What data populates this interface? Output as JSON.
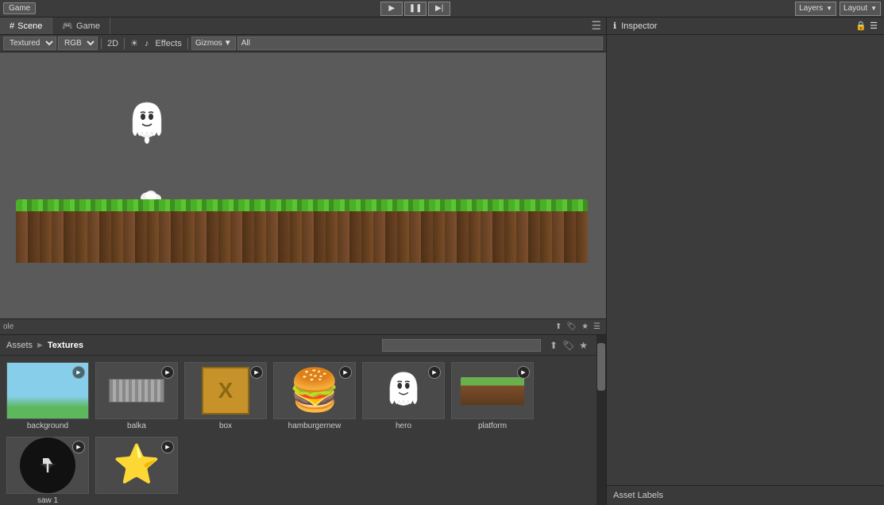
{
  "topbar": {
    "game_label": "Game",
    "layers_label": "Layers",
    "layout_label": "Layout",
    "play_icon": "▶",
    "pause_icon": "❚❚",
    "step_icon": "▶|"
  },
  "tabs": {
    "scene_label": "Scene",
    "game_label": "Game",
    "scene_hash": "#",
    "game_hash": "🎮"
  },
  "scene_toolbar": {
    "mode": "Textured",
    "color": "RGB",
    "view": "2D",
    "effects_label": "Effects",
    "gizmos_label": "Gizmos",
    "all_value": "All"
  },
  "inspector": {
    "title": "Inspector",
    "asset_labels_title": "Asset Labels"
  },
  "bottom_panel": {
    "console_label": "ole",
    "search_placeholder": "",
    "breadcrumb_assets": "Assets",
    "breadcrumb_sep": "►",
    "breadcrumb_textures": "Textures"
  },
  "assets": [
    {
      "id": "background",
      "label": "background",
      "type": "sky"
    },
    {
      "id": "balka",
      "label": "balka",
      "type": "beam"
    },
    {
      "id": "box",
      "label": "box",
      "type": "crate"
    },
    {
      "id": "hamburgernew",
      "label": "hamburgernew",
      "type": "burger"
    },
    {
      "id": "hero",
      "label": "hero",
      "type": "ghost"
    },
    {
      "id": "platform",
      "label": "platform",
      "type": "platform"
    },
    {
      "id": "saw1",
      "label": "saw 1",
      "type": "saw"
    },
    {
      "id": "star",
      "label": "",
      "type": "star"
    }
  ]
}
